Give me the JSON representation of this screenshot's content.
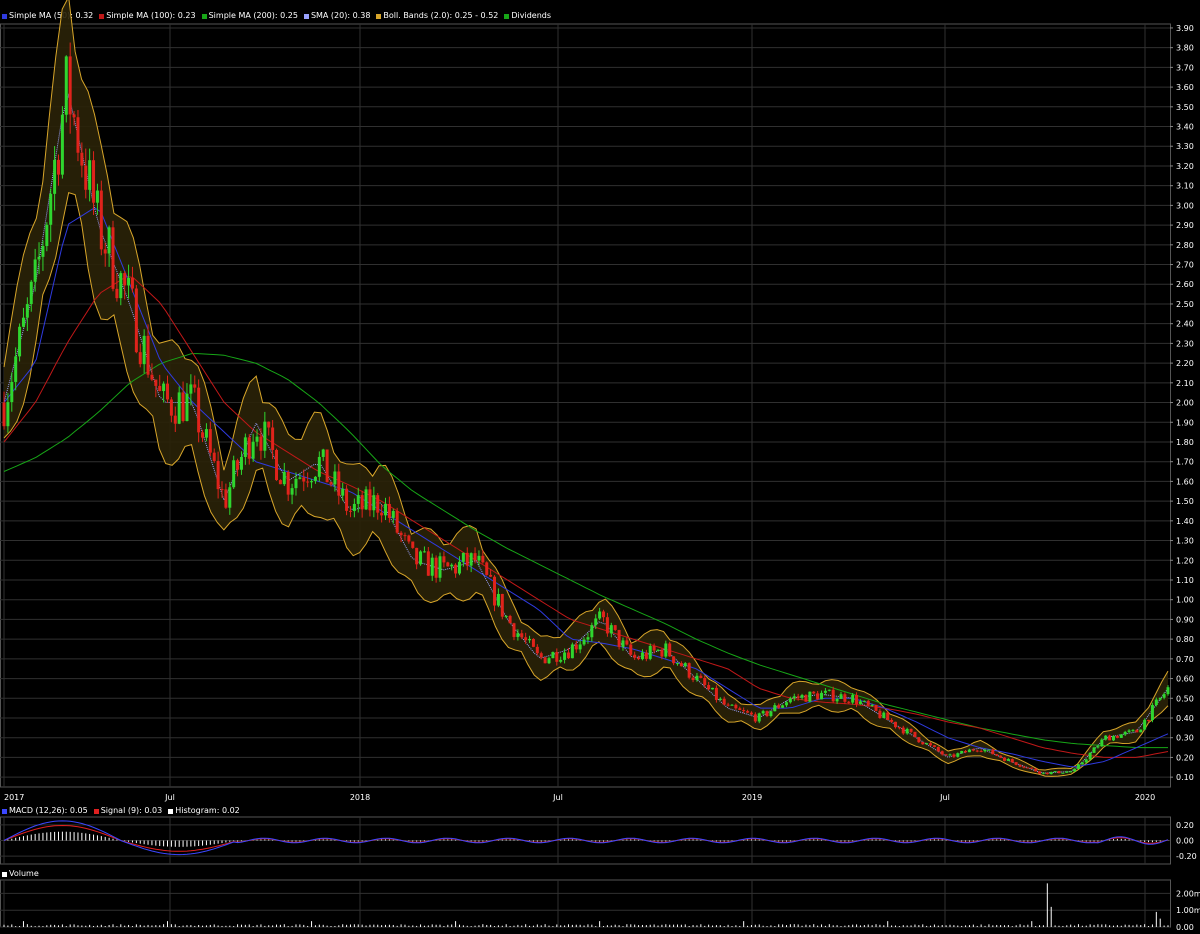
{
  "colors": {
    "background": "#000000",
    "grid": "#303030",
    "candle_up": "#2fd62f",
    "candle_down": "#e0231b",
    "sma50": "#2f3be0",
    "sma100": "#c01818",
    "sma200": "#17a617",
    "sma20": "#9aa2ff",
    "bollinger": "#d8a62a",
    "bollinger_fill": "#2a2208",
    "macd": "#3b47ff",
    "signal": "#e02020",
    "histogram": "#ffffff"
  },
  "price_legend": [
    {
      "label": "Simple MA (50): 0.32",
      "color": "#2f3be0"
    },
    {
      "label": "Simple MA (100): 0.23",
      "color": "#c01818"
    },
    {
      "label": "Simple MA (200): 0.25",
      "color": "#17a617"
    },
    {
      "label": "SMA (20): 0.38",
      "color": "#9aa2ff"
    },
    {
      "label": "Boll. Bands (2.0): 0.25 - 0.52",
      "color": "#d8a62a"
    },
    {
      "label": "Dividends",
      "color": "#17a617"
    }
  ],
  "macd_legend": [
    {
      "label": "MACD (12,26): 0.05",
      "color": "#3b47ff"
    },
    {
      "label": "Signal (9): 0.03",
      "color": "#e02020"
    },
    {
      "label": "Histogram: 0.02",
      "color": "#ffffff"
    }
  ],
  "volume_legend": [
    {
      "label": "Volume",
      "color": "#ffffff"
    }
  ],
  "chart_data": [
    {
      "type": "candlestick",
      "title": "",
      "x_labels": [
        "2017",
        "Jul",
        "2018",
        "Jul",
        "2019",
        "Jul",
        "2020"
      ],
      "y_ticks": [
        "3.90",
        "3.80",
        "3.70",
        "3.60",
        "3.50",
        "3.40",
        "3.30",
        "3.20",
        "3.10",
        "3.00",
        "2.90",
        "2.80",
        "2.70",
        "2.60",
        "2.50",
        "2.40",
        "2.30",
        "2.20",
        "2.10",
        "2.00",
        "1.90",
        "1.80",
        "1.70",
        "1.60",
        "1.50",
        "1.40",
        "1.30",
        "1.20",
        "1.10",
        "1.00",
        "0.90",
        "0.80",
        "0.70",
        "0.60",
        "0.50",
        "0.40",
        "0.30",
        "0.20",
        "0.10"
      ],
      "ylim": [
        0.05,
        3.92
      ],
      "grid": true,
      "legend_position": "top-left",
      "price_path": [
        {
          "t": "2017-01",
          "close": 2.0
        },
        {
          "t": "2017-02",
          "close": 2.6
        },
        {
          "t": "2017-03",
          "close": 3.6
        },
        {
          "t": "2017-04",
          "close": 2.9
        },
        {
          "t": "2017-05",
          "close": 2.5
        },
        {
          "t": "2017-06",
          "close": 2.0
        },
        {
          "t": "2017-07",
          "close": 2.0
        },
        {
          "t": "2017-08",
          "close": 1.5
        },
        {
          "t": "2017-09",
          "close": 1.9
        },
        {
          "t": "2017-10",
          "close": 1.6
        },
        {
          "t": "2017-11",
          "close": 1.7
        },
        {
          "t": "2017-12",
          "close": 1.45
        },
        {
          "t": "2018-01",
          "close": 1.5
        },
        {
          "t": "2018-02",
          "close": 1.2
        },
        {
          "t": "2018-03",
          "close": 1.15
        },
        {
          "t": "2018-04",
          "close": 1.2
        },
        {
          "t": "2018-05",
          "close": 0.9
        },
        {
          "t": "2018-06",
          "close": 0.7
        },
        {
          "t": "2018-07",
          "close": 0.75
        },
        {
          "t": "2018-08",
          "close": 0.9
        },
        {
          "t": "2018-09",
          "close": 0.7
        },
        {
          "t": "2018-10",
          "close": 0.75
        },
        {
          "t": "2018-11",
          "close": 0.6
        },
        {
          "t": "2018-12",
          "close": 0.45
        },
        {
          "t": "2019-01",
          "close": 0.4
        },
        {
          "t": "2019-02",
          "close": 0.5
        },
        {
          "t": "2019-03",
          "close": 0.52
        },
        {
          "t": "2019-04",
          "close": 0.5
        },
        {
          "t": "2019-05",
          "close": 0.4
        },
        {
          "t": "2019-06",
          "close": 0.3
        },
        {
          "t": "2019-07",
          "close": 0.2
        },
        {
          "t": "2019-08",
          "close": 0.25
        },
        {
          "t": "2019-09",
          "close": 0.18
        },
        {
          "t": "2019-10",
          "close": 0.12
        },
        {
          "t": "2019-11",
          "close": 0.13
        },
        {
          "t": "2019-12",
          "close": 0.3
        },
        {
          "t": "2020-01",
          "close": 0.33
        },
        {
          "t": "2020-02",
          "close": 0.55
        }
      ],
      "indicators": {
        "sma50": [
          2.0,
          2.2,
          2.9,
          3.0,
          2.6,
          2.2,
          2.0,
          1.85,
          1.7,
          1.65,
          1.6,
          1.55,
          1.45,
          1.35,
          1.25,
          1.15,
          1.05,
          0.95,
          0.8,
          0.78,
          0.75,
          0.7,
          0.65,
          0.55,
          0.45,
          0.45,
          0.5,
          0.5,
          0.45,
          0.38,
          0.3,
          0.25,
          0.22,
          0.18,
          0.15,
          0.18,
          0.25,
          0.32
        ],
        "sma100": [
          1.8,
          2.0,
          2.3,
          2.55,
          2.65,
          2.5,
          2.25,
          2.0,
          1.85,
          1.75,
          1.65,
          1.58,
          1.5,
          1.4,
          1.3,
          1.2,
          1.1,
          1.0,
          0.9,
          0.85,
          0.8,
          0.75,
          0.7,
          0.65,
          0.55,
          0.5,
          0.48,
          0.47,
          0.45,
          0.42,
          0.38,
          0.35,
          0.3,
          0.25,
          0.22,
          0.2,
          0.2,
          0.23
        ],
        "sma200": [
          1.65,
          1.72,
          1.82,
          1.95,
          2.1,
          2.2,
          2.25,
          2.24,
          2.2,
          2.12,
          2.0,
          1.85,
          1.68,
          1.55,
          1.45,
          1.35,
          1.26,
          1.18,
          1.1,
          1.02,
          0.95,
          0.88,
          0.8,
          0.73,
          0.67,
          0.62,
          0.57,
          0.52,
          0.47,
          0.43,
          0.39,
          0.35,
          0.32,
          0.29,
          0.27,
          0.26,
          0.25,
          0.25
        ]
      }
    },
    {
      "type": "line",
      "title": "MACD",
      "y_ticks": [
        "0.20",
        "0.00",
        "-0.20"
      ],
      "ylim": [
        -0.3,
        0.3
      ]
    },
    {
      "type": "bar",
      "title": "Volume",
      "y_ticks": [
        "2.00m",
        "1.00m",
        "0.00"
      ],
      "ylim": [
        0,
        2.8
      ]
    }
  ]
}
